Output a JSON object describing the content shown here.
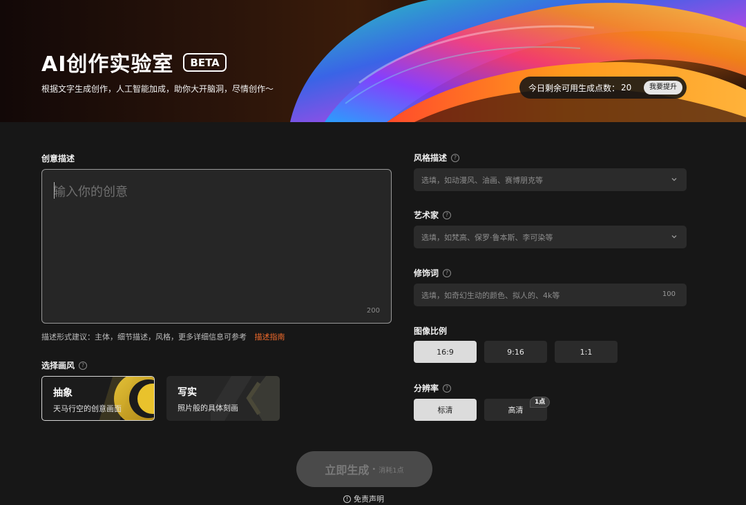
{
  "banner": {
    "title": "AI创作实验室",
    "badge": "BETA",
    "subtitle": "根据文字生成创作，人工智能加成，助你大开脑洞，尽情创作～",
    "credits_label": "今日剩余可用生成点数：",
    "credits_value": "20",
    "upgrade_label": "我要提升"
  },
  "left": {
    "desc_label": "创意描述",
    "desc_placeholder": "输入你的创意",
    "desc_max": "200",
    "hint_text": "描述形式建议：主体，细节描述，风格，更多详细信息可参考",
    "hint_link": "描述指南",
    "style_label": "选择画风",
    "styles": [
      {
        "title": "抽象",
        "sub": "天马行空的创意画面",
        "active": true
      },
      {
        "title": "写实",
        "sub": "照片般的具体刻画",
        "active": false
      }
    ]
  },
  "right": {
    "style_desc_label": "风格描述",
    "style_desc_placeholder": "选填，如动漫风、油画、赛博朋克等",
    "artist_label": "艺术家",
    "artist_placeholder": "选填，如梵高、保罗·鲁本斯、李可染等",
    "modifier_label": "修饰词",
    "modifier_placeholder": "选填，如奇幻生动的颜色、拟人的、4k等",
    "modifier_max": "100",
    "ratio_label": "图像比例",
    "ratios": [
      "16:9",
      "9:16",
      "1:1"
    ],
    "ratio_selected": "16:9",
    "resolution_label": "分辨率",
    "resolutions": [
      "标清",
      "高清"
    ],
    "resolution_selected": "标清",
    "hd_badge": "1点"
  },
  "bottom": {
    "generate_label": "立即生成",
    "generate_cost": "消耗1点",
    "disclaimer": "免责声明"
  },
  "icons": {
    "help": "question-circle-icon",
    "chevron": "chevron-down-icon",
    "info": "info-circle-icon"
  },
  "colors": {
    "background": "#171717",
    "link": "#f06a2b",
    "input_bg": "#2b2b2b"
  }
}
